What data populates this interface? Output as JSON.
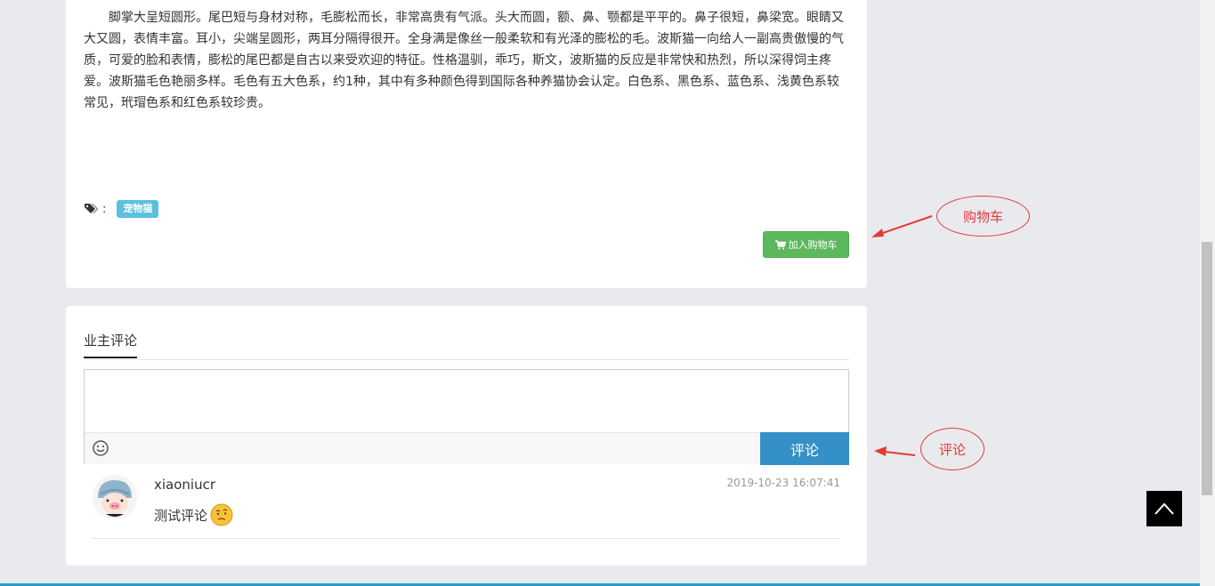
{
  "product": {
    "description": "脚掌大呈短圆形。尾巴短与身材对称，毛膨松而长，非常高贵有气派。头大而圆，额、鼻、颚都是平平的。鼻子很短，鼻梁宽。眼睛又大又圆，表情丰富。耳小，尖端呈圆形，两耳分隔得很开。全身满是像丝一般柔软和有光泽的膨松的毛。波斯猫一向给人一副高贵傲慢的气质，可爱的脸和表情，膨松的尾巴都是自古以来受欢迎的特征。性格温驯，乖巧，斯文，波斯猫的反应是非常快和热烈，所以深得饲主疼爱。波斯猫毛色艳丽多样。毛色有五大色系，约1种，其中有多种颜色得到国际各种养猫协会认定。白色系、黑色系、蓝色系、浅黄色系较常见，玳瑁色系和红色系较珍贵。",
    "tags_colon": ":",
    "tag": "宠物猫",
    "add_to_cart_label": "加入购物车",
    "tag_icon": "tags-icon",
    "cart_icon": "shopping-cart-icon"
  },
  "comments": {
    "tab_label": "业主评论",
    "input_value": "",
    "submit_label": "评论",
    "emoji_icon": "smiley-icon",
    "items": [
      {
        "user": "xiaoniucr",
        "time": "2019-10-23 16:07:41",
        "text": "测试评论",
        "emoji": "thinking-face-emoji"
      }
    ]
  },
  "annotations": {
    "cart": "购物车",
    "comment": "评论",
    "color": "#e53935"
  },
  "back_to_top_icon": "chevron-up-icon",
  "colors": {
    "cart_button": "#5cb85c",
    "submit_button": "#3590c8",
    "tag_badge": "#5bc0de",
    "background": "#e9eaee"
  }
}
